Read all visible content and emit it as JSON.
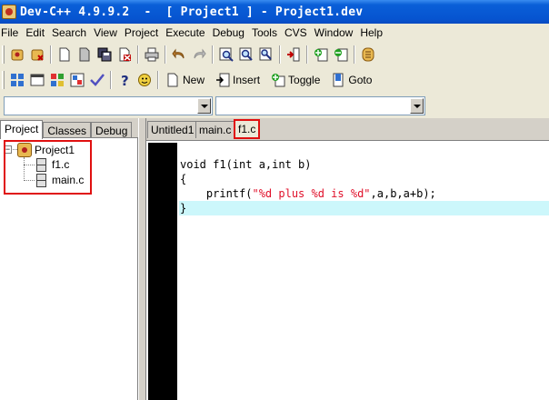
{
  "window": {
    "title": "Dev-C++ 4.9.9.2  -  [ Project1 ] - Project1.dev"
  },
  "menu": [
    "File",
    "Edit",
    "Search",
    "View",
    "Project",
    "Execute",
    "Debug",
    "Tools",
    "CVS",
    "Window",
    "Help"
  ],
  "toolbar2": {
    "new_label": "New",
    "insert_label": "Insert",
    "toggle_label": "Toggle",
    "goto_label": "Goto"
  },
  "left_panel": {
    "tabs": [
      "Project",
      "Classes",
      "Debug"
    ],
    "active_tab": "Project",
    "tree": {
      "project": "Project1",
      "files": [
        "f1.c",
        "main.c"
      ]
    }
  },
  "editor": {
    "tabs": [
      "Untitled1",
      "main.c",
      "f1.c"
    ],
    "active_tab": "f1.c",
    "code": {
      "line1": "void f1(int a,int b)",
      "line2": "{",
      "line3_pre": "    printf(",
      "line3_str": "\"%d plus %d is %d\"",
      "line3_post": ",a,b,a+b);",
      "line4": "}"
    }
  },
  "colors": {
    "title_bar": "#0654d0",
    "current_line": "#ccf7fb",
    "string": "#e0102a",
    "highlight_box": "#e01010",
    "gutter": "#000000"
  }
}
